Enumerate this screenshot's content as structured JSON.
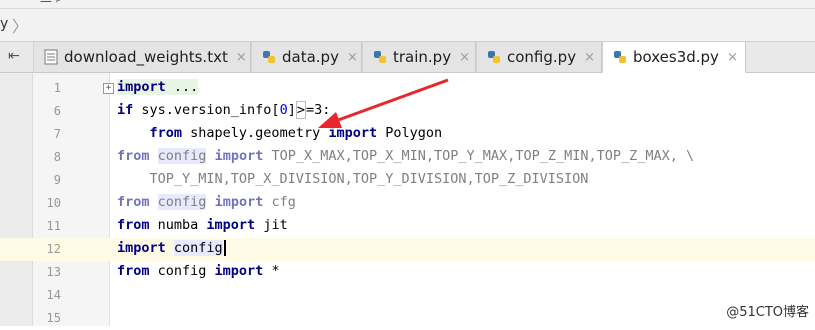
{
  "breadcrumb": {
    "top_fragment": "—  ᵖ",
    "crumb": "y",
    "separator": "〉"
  },
  "tabbar": {
    "pin_icon": "pin-icon",
    "tabs": [
      {
        "label": "download_weights.txt",
        "icon": "text-file-icon",
        "active": false
      },
      {
        "label": "data.py",
        "icon": "python-file-icon",
        "active": false
      },
      {
        "label": "train.py",
        "icon": "python-file-icon",
        "active": false
      },
      {
        "label": "config.py",
        "icon": "python-file-icon",
        "active": false
      },
      {
        "label": "boxes3d.py",
        "icon": "python-file-icon",
        "active": true
      }
    ],
    "close_glyph": "×"
  },
  "editor": {
    "line_numbers": [
      "1",
      "6",
      "7",
      "8",
      "9",
      "10",
      "11",
      "12",
      "13",
      "14",
      "15"
    ],
    "current_line": "12",
    "lines": {
      "l1": {
        "kw": "import",
        "rest": " ..."
      },
      "l6": {
        "kw": "if",
        "a": " sys.version_info[",
        "b": "0",
        "c": "]",
        "d": ">",
        "e": "=3:"
      },
      "l7": {
        "indent": "    ",
        "kw1": "from",
        "a": " shapely.geometry ",
        "kw2": "import",
        "b": " Polygon"
      },
      "l8": {
        "kw1": "from",
        "mod": "config",
        "kw2": "import",
        "rest": " TOP_X_MAX,TOP_X_MIN,TOP_Y_MAX,TOP_Z_MIN,TOP_Z_MAX, \\"
      },
      "l9": {
        "rest": "    TOP_Y_MIN,TOP_X_DIVISION,TOP_Y_DIVISION,TOP_Z_DIVISION"
      },
      "l10": {
        "kw1": "from",
        "mod": "config",
        "kw2": "import",
        "rest": " cfg"
      },
      "l11": {
        "kw1": "from",
        "a": " numba ",
        "kw2": "import",
        "b": " jit"
      },
      "l12": {
        "kw": "import",
        "mod": "config"
      },
      "l13": {
        "kw1": "from",
        "a": " config ",
        "kw2": "import",
        "b": " *"
      }
    }
  },
  "watermark": "@51CTO博客",
  "colors": {
    "keyword": "#000080",
    "annotation_arrow": "#e8262b",
    "current_line": "#fffae3"
  }
}
